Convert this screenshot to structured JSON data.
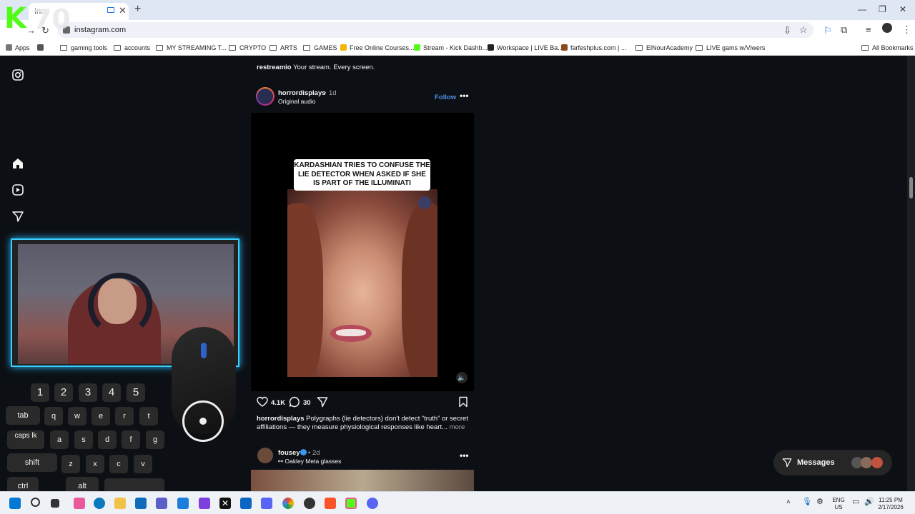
{
  "browser": {
    "tab_title": "In...",
    "address": "instagram.com",
    "bookmarks": [
      "Apps",
      "gaming tools",
      "accounts",
      "MY STREAMING T...",
      "CRYPTO",
      "ARTS",
      "GAMES",
      "Free Online Courses...",
      "Stream - Kick Dashb...",
      "Workspace | LIVE Ba...",
      "farfeshplus.com | ...",
      "ElNourAcademy",
      "LIVE gams w/Viwers",
      "All Bookmarks"
    ]
  },
  "overlay": {
    "kick_count": "70",
    "keys": {
      "numbers": [
        "1",
        "2",
        "3",
        "4",
        "5"
      ],
      "row_tab": [
        "tab",
        "q",
        "w",
        "e",
        "r",
        "t"
      ],
      "row_caps": [
        "caps lk",
        "a",
        "s",
        "d",
        "f",
        "g"
      ],
      "row_shift": [
        "shift",
        "z",
        "x",
        "c",
        "v"
      ],
      "row_ctrl": [
        "ctrl",
        "alt"
      ]
    }
  },
  "feed": {
    "prev_caption_user": "restreamio",
    "prev_caption_text": "Your stream. Every screen.",
    "post1": {
      "username": "horrordisplays",
      "time": "1d",
      "audio": "Original audio",
      "follow": "Follow",
      "video_caption": "KARDASHIAN TRIES TO CONFUSE THE LIE DETECTOR WHEN ASKED IF SHE IS PART OF THE ILLUMINATI",
      "likes": "4.1K",
      "comments": "30",
      "caption_user": "horrordisplays",
      "caption_line1": "Polygraphs (lie detectors) don't detect “truth” or secret",
      "caption_line2": "affiliations — they measure physiological responses like heart...",
      "more": "more"
    },
    "post2": {
      "username": "fousey",
      "time": "2d",
      "audio": "Oakley Meta glasses"
    }
  },
  "messages_label": "Messages",
  "taskbar": {
    "lang_top": "ENG",
    "lang_bottom": "US",
    "time": "11:25 PM",
    "date": "2/17/2026"
  },
  "colors": {
    "kick_green": "#53fc18",
    "follow_blue": "#4a90e2",
    "webcam_border": "#37d0ff"
  }
}
